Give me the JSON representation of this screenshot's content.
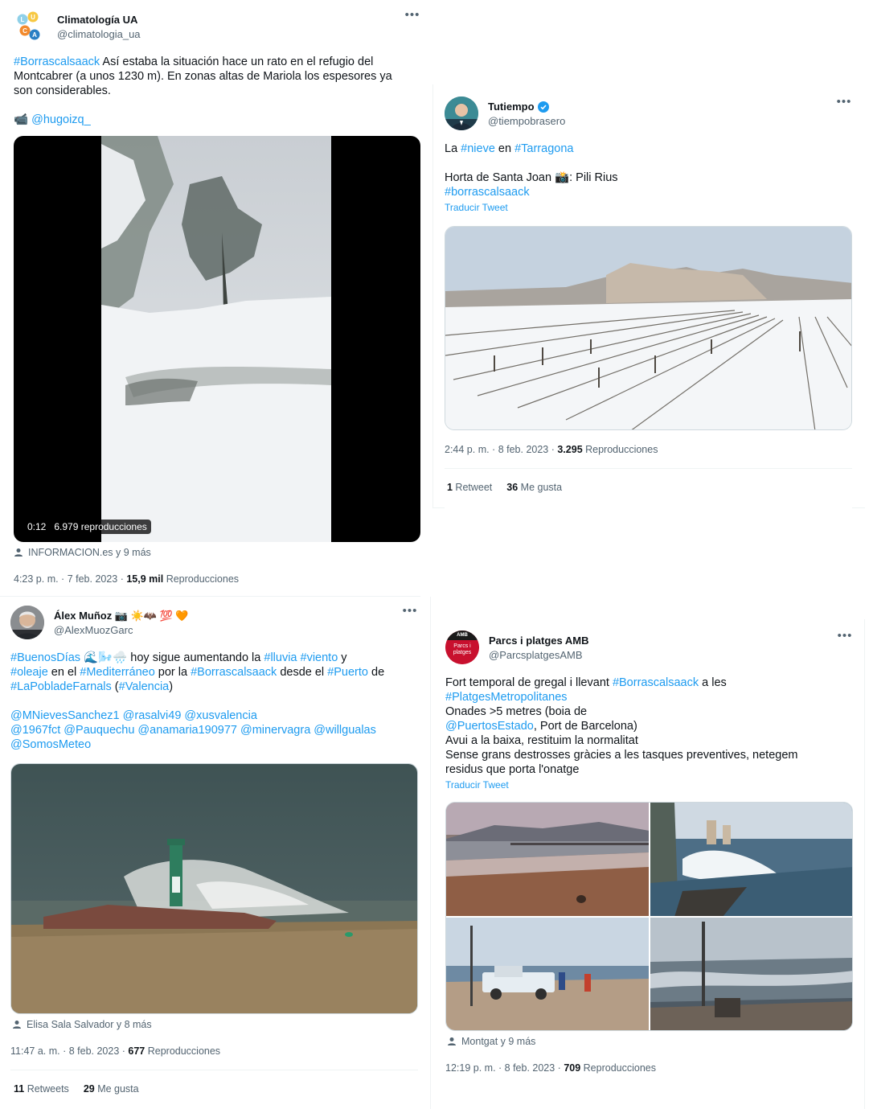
{
  "tweets": [
    {
      "author": "Climatología UA",
      "handle": "@climatologia_ua",
      "text_line1_tag": "#Borrascalsaack",
      "text_line1_rest": " Así estaba la situación hace un rato en el refugio del",
      "text_line2": "Montcabrer (a unos 1230 m). En zonas altas de Mariola los espesores ya",
      "text_line3": "son considerables.",
      "video_credit_emoji": "📹",
      "video_credit_handle": "@hugoizq_",
      "video_duration": "0:12",
      "video_views": "6.979 reproducciones",
      "credit": "INFORMACION.es y 9 más",
      "timestamp": "4:23 p. m. · 7 feb. 2023 · ",
      "views_count": "15,9 mil",
      "views_label": " Reproducciones"
    },
    {
      "author": "Tutiempo",
      "handle": "@tiempobrasero",
      "text_prefix": "La ",
      "tag_nieve": "#nieve",
      "text_en": " en ",
      "tag_tarragona": "#Tarragona",
      "location_text": "Horta de Santa Joan  📸: Pili Rius",
      "tag_borrasca": "#borrascalsaack",
      "translate": "Traducir Tweet",
      "timestamp": "2:44 p. m. · 8 feb. 2023 · ",
      "views_count": "3.295",
      "views_label": " Reproducciones",
      "retweets_count": "1",
      "retweets_label": " Retweet",
      "likes_count": "36",
      "likes_label": " Me gusta"
    },
    {
      "author": "Álex Muñoz 📷 ☀️🦇 💯 🧡",
      "handle": "@AlexMuozGarc",
      "line1_tag1": "#BuenosDías",
      "line1_emoji": " 🌊🌬️🌧️ ",
      "line1_mid": "hoy sigue aumentando la ",
      "line1_tag2": "#lluvia",
      "line1_sp": " ",
      "line1_tag3": "#viento",
      "line1_end": " y",
      "line2_tag1": "#oleaje",
      "line2_t1": " en el ",
      "line2_tag2": "#Mediterráneo",
      "line2_t2": " por la ",
      "line2_tag3": "#Borrascalsaack",
      "line2_t3": " desde el ",
      "line2_tag4": "#Puerto",
      "line2_t4": " de",
      "line3_tag1": "#LaPobladeFarnals",
      "line3_t1": " (",
      "line3_tag2": "#Valencia",
      "line3_t2": ")",
      "mentions1": "@MNievesSanchez1 @rasalvi49 @xusvalencia",
      "mentions2": "@1967fct @Pauquechu @anamaria190977 @minervagra @willgualas",
      "mentions3": "@SomosMeteo",
      "credit": "Elisa Sala Salvador y 8 más",
      "timestamp": "11:47 a. m. · 8 feb. 2023 · ",
      "views_count": "677",
      "views_label": " Reproducciones",
      "retweets_count": "11",
      "retweets_label": " Retweets",
      "likes_count": "29",
      "likes_label": " Me gusta"
    },
    {
      "author": "Parcs i platges AMB",
      "handle": "@ParcsplatgesAMB",
      "avatar_text_top": "AMB",
      "avatar_text_bottom": "Parcs i platges",
      "line1_t1": "Fort temporal de gregal i llevant ",
      "line1_tag": "#Borrascalsaack",
      "line1_t2": " a les",
      "line2_tag": "#PlatgesMetropolitanes",
      "line3": "Onades >5 metres (boia de",
      "line4_tag": "@PuertosEstado",
      "line4_t": ", Port de Barcelona)",
      "line5": "Avui a la baixa, restituim la normalitat",
      "line6": "Sense grans destrosses gràcies a les tasques preventives, netegem",
      "line7": "residus que porta l'onatge",
      "translate": "Traducir Tweet",
      "credit": "Montgat y 9 más",
      "timestamp": "12:19 p. m. · 8 feb. 2023 · ",
      "views_count": "709",
      "views_label": " Reproducciones"
    }
  ],
  "colors": {
    "link": "#1d9bf0",
    "text": "#0f1419",
    "muted": "#536471",
    "border": "#eff3f4"
  }
}
